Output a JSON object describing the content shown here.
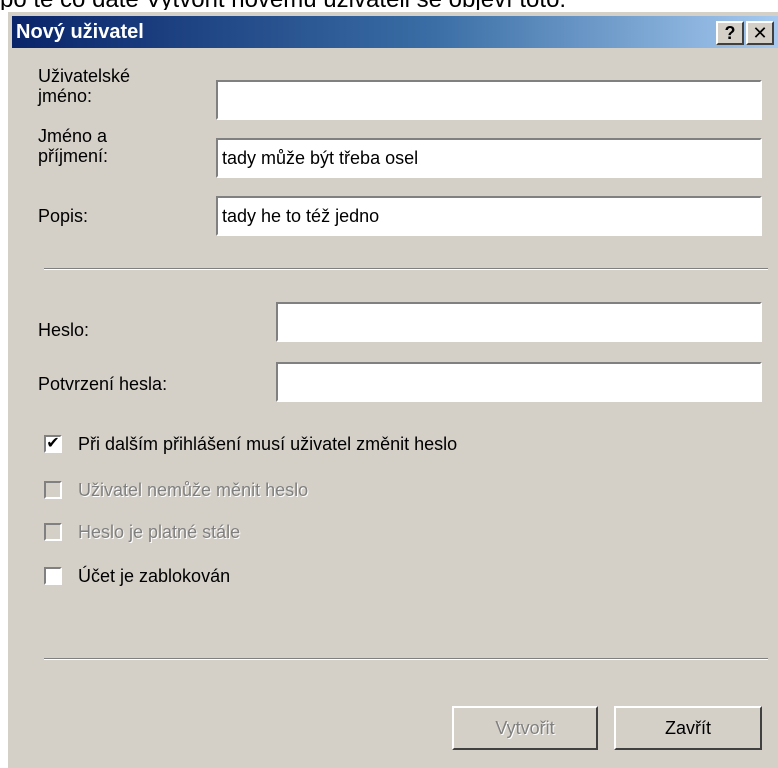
{
  "caption": "po té co dáte Vytvořit novému uživateli se objeví toto:",
  "window": {
    "title": "Nový uživatel",
    "help_label": "?",
    "close_label": "✕"
  },
  "fields": {
    "username": {
      "label_line1": "Uživatelské",
      "label_line2": "jméno:",
      "value": ""
    },
    "fullname": {
      "label_line1": "Jméno a",
      "label_line2": "příjmení:",
      "value": "tady může být třeba osel"
    },
    "description": {
      "label": "Popis:",
      "value": "tady he to též jedno"
    },
    "password": {
      "label": "Heslo:",
      "value": ""
    },
    "password_confirm": {
      "label": "Potvrzení hesla:",
      "value": ""
    }
  },
  "checkboxes": [
    {
      "label": "Při dalším přihlášení musí uživatel změnit heslo",
      "checked": true,
      "enabled": true
    },
    {
      "label": "Uživatel nemůže měnit heslo",
      "checked": false,
      "enabled": false
    },
    {
      "label": "Heslo je platné stále",
      "checked": false,
      "enabled": false
    },
    {
      "label": "Účet je zablokován",
      "checked": false,
      "enabled": true
    }
  ],
  "buttons": {
    "create": "Vytvořit",
    "close": "Zavřít"
  },
  "colors": {
    "titlebar_start": "#0a246a",
    "titlebar_end": "#a6caf0",
    "dialog_bg": "#d4d0c8"
  }
}
